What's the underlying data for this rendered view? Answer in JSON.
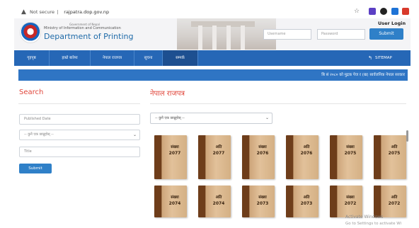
{
  "browser": {
    "security_label": "Not secure",
    "url": "rajpatra.dop.gov.np"
  },
  "header": {
    "gov_line1": "Government of Nepal",
    "gov_line2": "Ministry of Information and Communication",
    "department": "Department of Printing",
    "login_title": "User Login",
    "username_placeholder": "Username",
    "password_placeholder": "Password",
    "submit_label": "Submit"
  },
  "nav": {
    "items": [
      "गृहपृष्ठ",
      "हाम्रो बारेमा",
      "नेपाल राजपत्र",
      "सूचना",
      "सम्पर्क"
    ],
    "active_index": 4,
    "sitemap_label": "SITEMAP"
  },
  "marquee": {
    "text": "बि सं २०८० को मुद्रक पेज र (ख) सार्वजनिक नेपाल सरकार"
  },
  "search": {
    "title": "Search",
    "published_date_placeholder": "Published Date",
    "category_select": "-- कुनै एक छान्नुहोस् --",
    "title_placeholder": "Title",
    "submit_label": "Submit"
  },
  "main": {
    "title": "नेपाल राजपत्र",
    "select_value": "-- कुनै एक छान्नुहोस् --",
    "books": [
      {
        "label": "संख्या",
        "year": "2077"
      },
      {
        "label": "अति",
        "year": "2077"
      },
      {
        "label": "संख्या",
        "year": "2076"
      },
      {
        "label": "अति",
        "year": "2076"
      },
      {
        "label": "संख्या",
        "year": "2075"
      },
      {
        "label": "अति",
        "year": "2075"
      },
      {
        "label": "संख्या",
        "year": "2074"
      },
      {
        "label": "अति",
        "year": "2074"
      },
      {
        "label": "संख्या",
        "year": "2073"
      },
      {
        "label": "अति",
        "year": "2073"
      },
      {
        "label": "संख्या",
        "year": "2072"
      },
      {
        "label": "अति",
        "year": "2072"
      }
    ]
  },
  "watermark": {
    "line1": "Activate Windows",
    "line2": "Go to Settings to activate Wi"
  },
  "colors": {
    "nav_blue": "#2667b6",
    "accent_red": "#e0453a",
    "button_blue": "#2f80c8"
  }
}
